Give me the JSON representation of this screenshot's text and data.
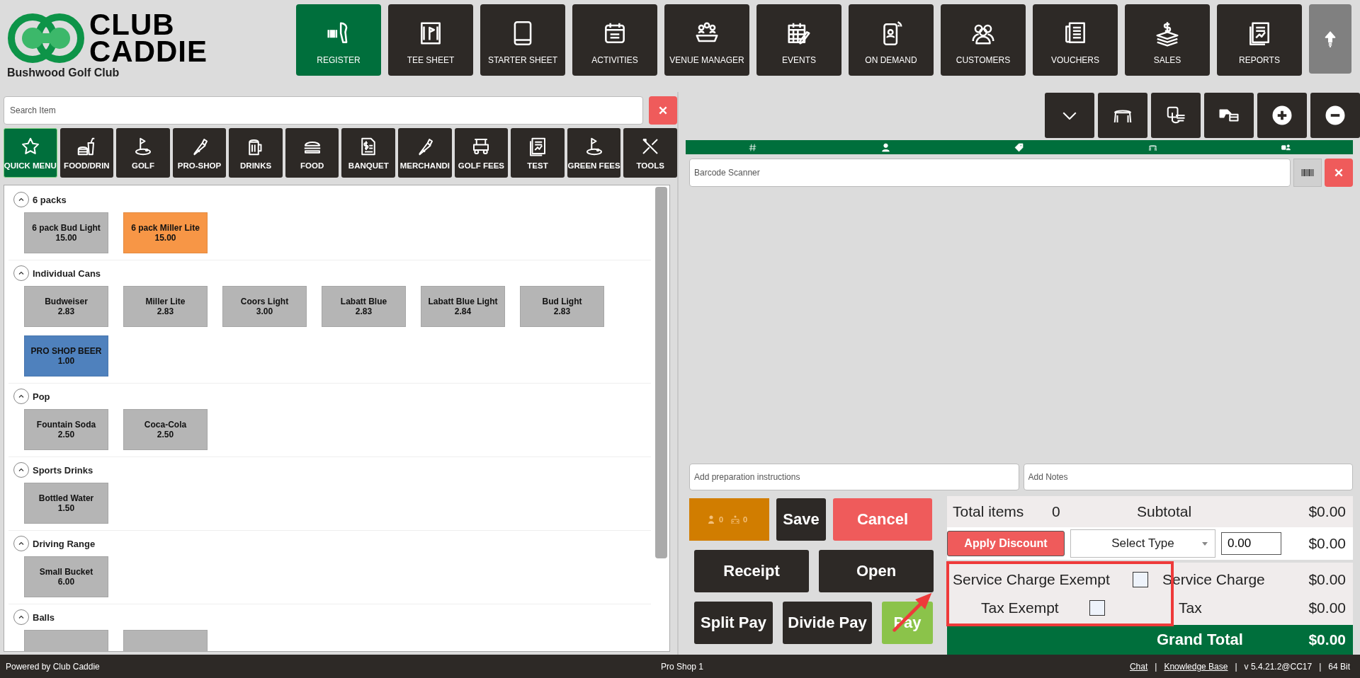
{
  "header": {
    "logo_lines": [
      "CLUB",
      "CADDIE"
    ],
    "club_name": "Bushwood Golf Club",
    "nav": [
      {
        "label": "REGISTER",
        "selected": true
      },
      {
        "label": "TEE SHEET",
        "selected": false
      },
      {
        "label": "STARTER SHEET",
        "selected": false
      },
      {
        "label": "ACTIVITIES",
        "selected": false
      },
      {
        "label": "VENUE MANAGER",
        "selected": false
      },
      {
        "label": "EVENTS",
        "selected": false
      },
      {
        "label": "ON DEMAND",
        "selected": false
      },
      {
        "label": "CUSTOMERS",
        "selected": false
      },
      {
        "label": "VOUCHERS",
        "selected": false
      },
      {
        "label": "SALES",
        "selected": false
      },
      {
        "label": "REPORTS",
        "selected": false
      }
    ]
  },
  "menu": {
    "search": {
      "placeholder": "Search Item"
    },
    "categories": [
      {
        "label": "QUICK MENU",
        "selected": true
      },
      {
        "label": "FOOD/DRIN",
        "selected": false
      },
      {
        "label": "GOLF",
        "selected": false
      },
      {
        "label": "PRO-SHOP",
        "selected": false
      },
      {
        "label": "DRINKS",
        "selected": false
      },
      {
        "label": "FOOD",
        "selected": false
      },
      {
        "label": "BANQUET",
        "selected": false
      },
      {
        "label": "MERCHANDI",
        "selected": false
      },
      {
        "label": "GOLF FEES",
        "selected": false
      },
      {
        "label": "TEST",
        "selected": false
      },
      {
        "label": "GREEN FEES",
        "selected": false
      },
      {
        "label": "TOOLS",
        "selected": false
      }
    ],
    "groups": [
      {
        "title": "6 packs",
        "expanded": true,
        "items": [
          {
            "kind": "tile",
            "name": "6 pack Bud Light",
            "price": "15.00",
            "color": "#b5b5b5"
          },
          {
            "kind": "tile",
            "name": "6 pack Miller Lite",
            "price": "15.00",
            "color": "#f79646"
          }
        ]
      },
      {
        "title": "Individual Cans",
        "expanded": true,
        "items": [
          {
            "kind": "tile",
            "name": "Budweiser",
            "price": "2.83",
            "color": "#b5b5b5"
          },
          {
            "kind": "tile",
            "name": "Miller Lite",
            "price": "2.83",
            "color": "#b5b5b5"
          },
          {
            "kind": "tile",
            "name": "Coors Light",
            "price": "3.00",
            "color": "#b5b5b5"
          },
          {
            "kind": "tile",
            "name": "Labatt Blue",
            "price": "2.83",
            "color": "#b5b5b5"
          },
          {
            "kind": "tile",
            "name": "Labatt Blue Light",
            "price": "2.84",
            "color": "#b5b5b5"
          },
          {
            "kind": "tile",
            "name": "Bud Light",
            "price": "2.83",
            "color": "#b5b5b5"
          },
          {
            "kind": "tile",
            "name": "PRO SHOP BEER",
            "price": "1.00",
            "color": "#4f81bd"
          }
        ]
      },
      {
        "title": "Pop",
        "expanded": true,
        "items": [
          {
            "kind": "tile",
            "name": "Fountain Soda",
            "price": "2.50",
            "color": "#b5b5b5"
          },
          {
            "kind": "tile",
            "name": "Coca-Cola",
            "price": "2.50",
            "color": "#b5b5b5"
          }
        ]
      },
      {
        "title": "Sports Drinks",
        "expanded": true,
        "items": [
          {
            "kind": "tile",
            "name": "Bottled Water",
            "price": "1.50",
            "color": "#b5b5b5"
          }
        ]
      },
      {
        "title": "Driving Range",
        "expanded": true,
        "items": [
          {
            "kind": "tile",
            "name": "Small Bucket",
            "price": "6.00",
            "color": "#b5b5b5"
          }
        ]
      },
      {
        "title": "Balls",
        "expanded": true,
        "items": [
          {
            "kind": "partial",
            "color": "#b5b5b5"
          },
          {
            "kind": "partial",
            "color": "#b5b5b5"
          }
        ]
      }
    ]
  },
  "order": {
    "barcode": {
      "placeholder": "Barcode Scanner"
    },
    "notes": [
      {
        "placeholder": "Add preparation instructions"
      },
      {
        "placeholder": "Add Notes"
      }
    ],
    "counter": {
      "counts": [
        "0",
        "0"
      ]
    },
    "actions": [
      [
        {
          "label": "Save",
          "kind": "dark"
        },
        {
          "label": "Cancel",
          "kind": "danger"
        }
      ],
      [
        {
          "label": "Receipt",
          "kind": "dark"
        },
        {
          "label": "Open",
          "kind": "dark"
        }
      ],
      [
        {
          "label": "Split Pay",
          "kind": "dark"
        },
        {
          "label": "Divide Pay",
          "kind": "dark"
        },
        {
          "label": "Pay",
          "kind": "success"
        }
      ]
    ],
    "totals": {
      "total_items_label": "Total items",
      "total_items": "0",
      "subtotal_label": "Subtotal",
      "subtotal": "$0.00",
      "discount_button": "Apply Discount",
      "discount_type": {
        "value": "Select Type"
      },
      "discount_amount": {
        "value": "0.00"
      },
      "discount": "$0.00",
      "service_charge_exempt": {
        "label": "Service Charge Exempt",
        "checked": false
      },
      "service_charge_label": "Service Charge",
      "service_charge": "$0.00",
      "tax_exempt": {
        "label": "Tax Exempt",
        "checked": false
      },
      "tax_label": "Tax",
      "tax": "$0.00",
      "grand_total_label": "Grand Total",
      "grand_total": "$0.00",
      "highlight": true,
      "pointer_arrow": true
    }
  },
  "status_bar": {
    "powered_by": "Powered by Club Caddie",
    "station": "Pro Shop 1",
    "items": [
      {
        "kind": "link",
        "text": "Chat"
      },
      {
        "kind": "sep",
        "text": "|"
      },
      {
        "kind": "link",
        "text": "Knowledge Base"
      },
      {
        "kind": "sep",
        "text": "|"
      },
      {
        "kind": "text",
        "text": "v 5.4.21.2@CC17"
      },
      {
        "kind": "sep",
        "text": "|"
      },
      {
        "kind": "text",
        "text": "64 Bit"
      }
    ]
  }
}
